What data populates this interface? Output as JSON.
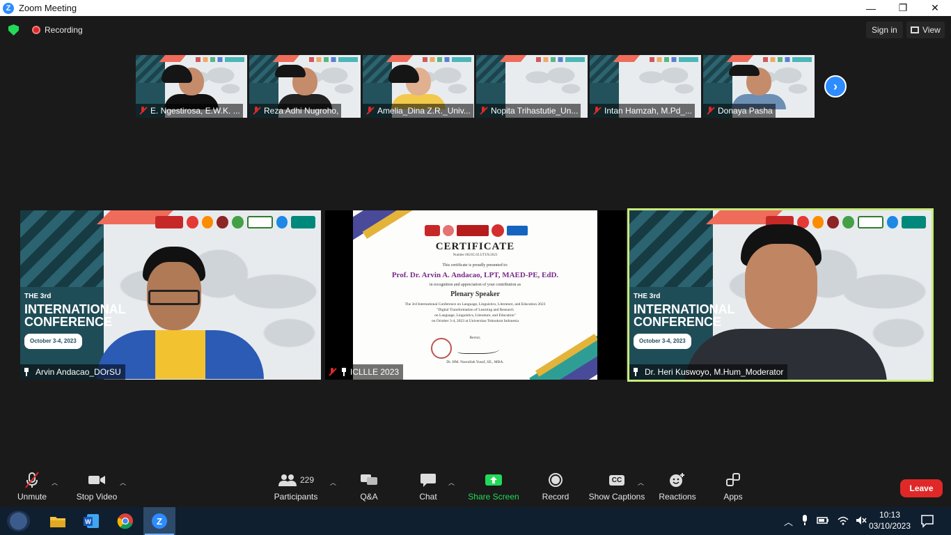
{
  "window": {
    "title": "Zoom Meeting",
    "minimize": "—",
    "restore": "❐",
    "close": "✕"
  },
  "topbar": {
    "recording_label": "Recording",
    "signin_label": "Sign in",
    "view_label": "View"
  },
  "strip": {
    "participants": [
      {
        "name": "E. Ngestirosa, E.W.K. ..."
      },
      {
        "name": "Reza Adhi Nugroho,"
      },
      {
        "name": "Amelia_Dina Z.R._Univ..."
      },
      {
        "name": "Nopita Trihastutie_Un..."
      },
      {
        "name": "Intan Hamzah, M.Pd_..."
      },
      {
        "name": "Donaya Pasha"
      }
    ],
    "next_label": "›"
  },
  "tiles": {
    "left": {
      "name": "Arvin Andacao_DOrSU",
      "conf_title_1": "THE 3rd",
      "conf_title_2": "INTERNATIONAL",
      "conf_title_3": "CONFERENCE",
      "conf_date": "October 3-4, 2023"
    },
    "center": {
      "name": "ICLLLE 2023",
      "cert_title": "CERTIFICATE",
      "cert_number": "Number 002/IC.03.UTI/X/2023",
      "cert_presented": "This certificate is proudly presented to:",
      "cert_recipient": "Prof. Dr. Arvin A. Andacao, LPT, MAED-PE, EdD.",
      "cert_recognition": "in recognition and appreciation of your contribution as",
      "cert_role": "Plenary Speaker",
      "cert_line1": "The 3rd International Conference on Language, Linguistics, Literature, and Education 2023",
      "cert_line2": "\"Digital Transformation of Learning and Research",
      "cert_line3": "on Language, Linguistics, Literature, and Education\"",
      "cert_line4": "on October 3-4, 2023 at Universitas Teknokrat Indonesia",
      "cert_rector": "Rector,",
      "cert_signer": "Dr. HM. Nasrullah Yusuf, SE., MBA."
    },
    "right": {
      "name": "Dr. Heri Kuswoyo, M.Hum_Moderator",
      "conf_title_1": "THE 3rd",
      "conf_title_2": "INTERNATIONAL",
      "conf_title_3": "CONFERENCE",
      "conf_date": "October 3-4, 2023"
    }
  },
  "toolbar": {
    "unmute": "Unmute",
    "stop_video": "Stop Video",
    "participants_count": "229",
    "participants": "Participants",
    "qa": "Q&A",
    "chat": "Chat",
    "share_screen": "Share Screen",
    "record": "Record",
    "show_captions": "Show Captions",
    "captions_badge": "CC",
    "reactions": "Reactions",
    "apps": "Apps",
    "leave": "Leave"
  },
  "taskbar": {
    "time": "10:13",
    "date": "03/10/2023"
  },
  "colors": {
    "zoom_blue": "#2d8cff",
    "leave_red": "#e02828",
    "share_green": "#23d959",
    "active_speaker": "#c9ea7b"
  }
}
